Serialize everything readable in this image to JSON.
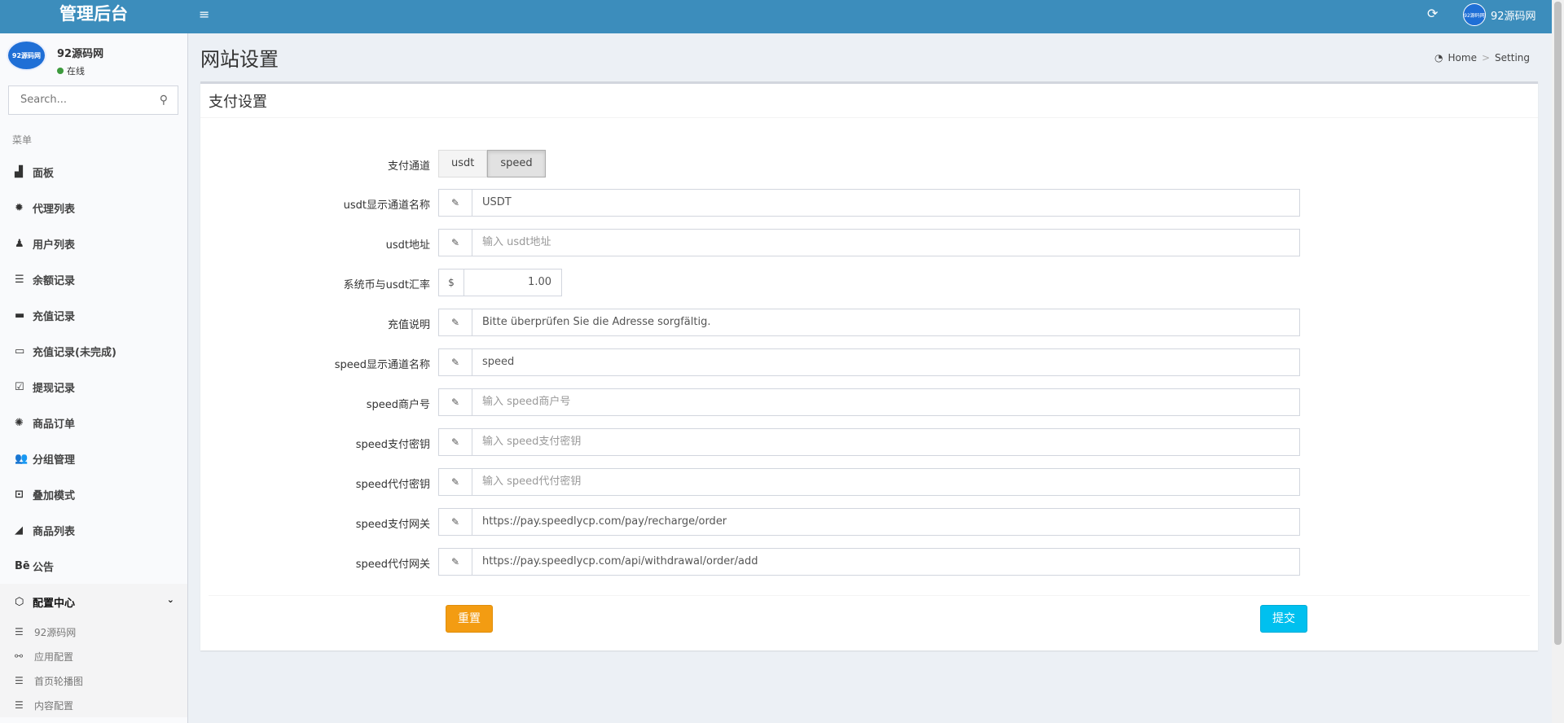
{
  "header": {
    "logo": "管理后台",
    "toggle_icon": "≡",
    "refresh_icon": "⟳",
    "user_avatar_text": "92源码网",
    "user_name": "92源码网"
  },
  "sidebar": {
    "user_avatar_text": "92源码网",
    "user_name": "92源码网",
    "status": "在线",
    "status_color": "#3d9a3d",
    "search_placeholder": "Search...",
    "menu_header": "菜单",
    "items": [
      {
        "icon": "area-chart-icon",
        "glyph": "▟",
        "label": "面板"
      },
      {
        "icon": "gear-icon",
        "glyph": "✹",
        "label": "代理列表"
      },
      {
        "icon": "user-icon",
        "glyph": "♟",
        "label": "用户列表"
      },
      {
        "icon": "list-icon",
        "glyph": "☰",
        "label": "余额记录"
      },
      {
        "icon": "battery-icon",
        "glyph": "▬",
        "label": "充值记录"
      },
      {
        "icon": "battery-empty-icon",
        "glyph": "▭",
        "label": "充值记录(未完成)"
      },
      {
        "icon": "check-square-icon",
        "glyph": "☑",
        "label": "提现记录"
      },
      {
        "icon": "cog-icon",
        "glyph": "✺",
        "label": "商品订单"
      },
      {
        "icon": "users-icon",
        "glyph": "👥",
        "label": "分组管理"
      },
      {
        "icon": "desktop-icon",
        "glyph": "⊡",
        "label": "叠加模式"
      },
      {
        "icon": "bar-chart-icon",
        "glyph": "◢",
        "label": "商品列表"
      },
      {
        "icon": "behance-icon",
        "glyph": "Bē",
        "label": "公告"
      }
    ],
    "group": {
      "icon": "hexagon-icon",
      "glyph": "⬡",
      "label": "配置中心",
      "chevron": "⌄"
    },
    "sub_items": [
      {
        "icon": "list-icon",
        "glyph": "☰",
        "label": "92源码网"
      },
      {
        "icon": "link-icon",
        "glyph": "⚯",
        "label": "应用配置"
      },
      {
        "icon": "list-icon",
        "glyph": "☰",
        "label": "首页轮播图"
      },
      {
        "icon": "list-icon",
        "glyph": "☰",
        "label": "内容配置"
      }
    ]
  },
  "content": {
    "title": "网站设置",
    "breadcrumb": {
      "icon": "dashboard-icon",
      "glyph": "◔",
      "home": "Home",
      "sep": ">",
      "current": "Setting"
    },
    "box_title": "支付设置",
    "channel": {
      "label": "支付通道",
      "options": [
        "usdt",
        "speed"
      ],
      "selected": "speed"
    },
    "fields": [
      {
        "label": "usdt显示通道名称",
        "value": "USDT",
        "placeholder": ""
      },
      {
        "label": "usdt地址",
        "value": "",
        "placeholder": "输入 usdt地址"
      },
      {
        "label": "系统币与usdt汇率",
        "addon": "$",
        "value": "1.00",
        "placeholder": ""
      },
      {
        "label": "充值说明",
        "value": "Bitte überprüfen Sie die Adresse sorgfältig.",
        "placeholder": ""
      },
      {
        "label": "speed显示通道名称",
        "value": "speed",
        "placeholder": ""
      },
      {
        "label": "speed商户号",
        "value": "",
        "placeholder": "输入 speed商户号"
      },
      {
        "label": "speed支付密钥",
        "value": "",
        "placeholder": "输入 speed支付密钥"
      },
      {
        "label": "speed代付密钥",
        "value": "",
        "placeholder": "输入 speed代付密钥"
      },
      {
        "label": "speed支付网关",
        "value": "https://pay.speedlycp.com/pay/recharge/order",
        "placeholder": ""
      },
      {
        "label": "speed代付网关",
        "value": "https://pay.speedlycp.com/api/withdrawal/order/add",
        "placeholder": ""
      }
    ],
    "pencil_glyph": "✎",
    "reset_label": "重置",
    "submit_label": "提交",
    "colors": {
      "header": "#3c8dbc",
      "reset": "#f39c12",
      "submit": "#00c0ef"
    }
  }
}
